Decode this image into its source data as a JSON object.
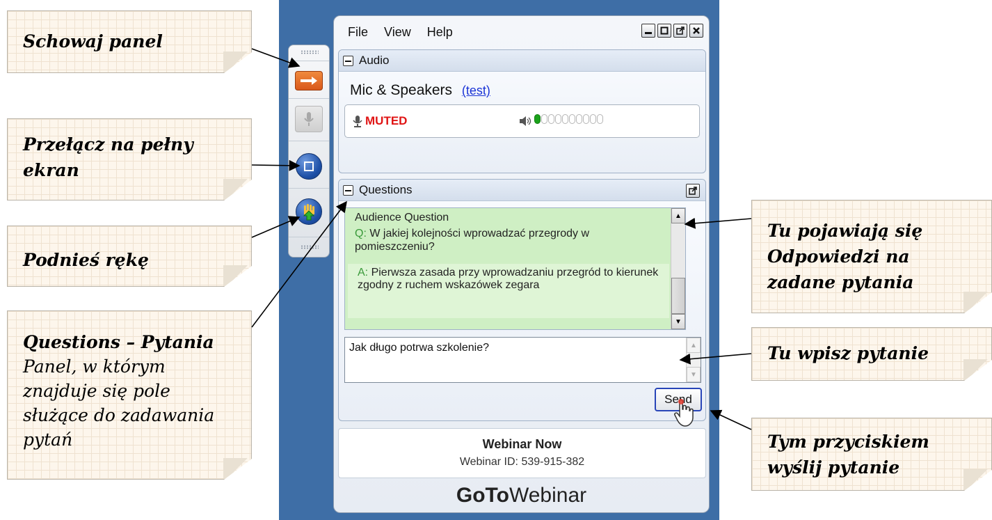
{
  "callouts": {
    "hide_panel": "Schowaj panel",
    "fullscreen": "Przełącz na pełny ekran",
    "raise_hand": "Podnieś rękę",
    "questions_title": "Questions – Pytania",
    "questions_desc": "Panel, w którym znajduje się pole służące do zadawania pytań",
    "answers": "Tu pojawiają się Odpowiedzi na zadane pytania",
    "type_question": "Tu wpisz pytanie",
    "send_hint": "Tym przyciskiem wyślij pytanie"
  },
  "menu": {
    "file": "File",
    "view": "View",
    "help": "Help"
  },
  "audio": {
    "header": "Audio",
    "mode": "Mic & Speakers",
    "test_link": "(test)",
    "status": "MUTED",
    "volume_level": 1,
    "volume_max": 10
  },
  "questions": {
    "header": "Questions",
    "audience_label": "Audience Question",
    "q_prefix": "Q:",
    "question_text": "W jakiej kolejności wprowadzać przegrody w pomieszczeniu?",
    "a_prefix": "A:",
    "answer_text": "Pierwsza zasada przy wprowadzaniu przegród to kierunek zgodny z ruchem wskazówek zegara",
    "input_value": "Jak długo potrwa szkolenie?",
    "send_label": "Send"
  },
  "webinar": {
    "title": "Webinar Now",
    "id_text": "Webinar ID: 539-915-382",
    "brand_goto": "GoTo",
    "brand_webinar": "Webinar"
  },
  "icons": [
    "hide-panel-arrow-icon",
    "microphone-icon",
    "fullscreen-icon",
    "raise-hand-icon",
    "minimize-icon",
    "restore-icon",
    "popout-icon",
    "close-icon",
    "speaker-icon",
    "cursor-icon"
  ],
  "colors": {
    "background": "#3e6ea6",
    "muted": "#e01515",
    "accent_orange": "#e06a26",
    "link": "#1a33d6"
  }
}
